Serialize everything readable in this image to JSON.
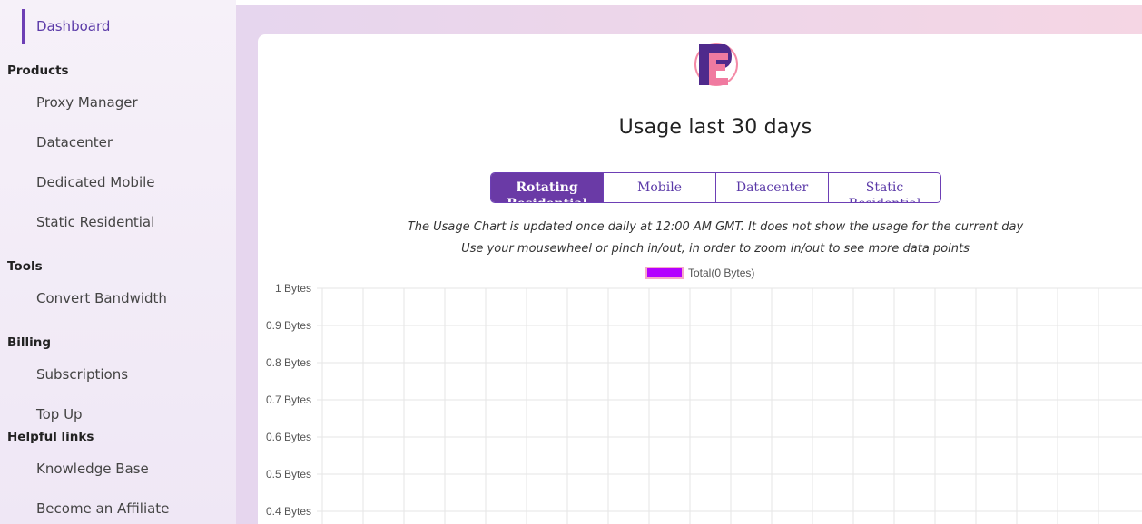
{
  "sidebar": {
    "active_item": "Dashboard",
    "sections": {
      "products": "Products",
      "tools": "Tools",
      "billing": "Billing",
      "helpful": "Helpful links"
    },
    "items": {
      "proxy_manager": "Proxy Manager",
      "datacenter": "Datacenter",
      "dedicated_mobile": "Dedicated Mobile",
      "static_residential": "Static Residential",
      "convert_bandwidth": "Convert Bandwidth",
      "subscriptions": "Subscriptions",
      "top_up": "Top Up",
      "knowledge_base": "Knowledge Base",
      "affiliate": "Become an Affiliate"
    }
  },
  "main": {
    "title": "Usage last 30 days",
    "tabs": {
      "rotating": "Rotating Residential",
      "mobile": "Mobile",
      "datacenter": "Datacenter",
      "static": "Static Residential"
    },
    "note1": "The Usage Chart is updated once daily at 12:00 AM GMT. It does not show the usage for the current day",
    "note2": "Use your mousewheel or pinch in/out, in order to zoom in/out to see more data points"
  },
  "colors": {
    "accent": "#6a3aa6",
    "series": "#b400ff",
    "series_border": "#f6a9c8"
  },
  "chart_data": {
    "type": "line",
    "legend": [
      "Total(0 Bytes)"
    ],
    "legend_position": "top-center",
    "y_tick_labels": [
      "1 Bytes",
      "0.9 Bytes",
      "0.8 Bytes",
      "0.7 Bytes",
      "0.6 Bytes",
      "0.5 Bytes",
      "0.4 Bytes"
    ],
    "ylim": [
      0,
      1
    ],
    "grid": true,
    "series": [
      {
        "name": "Total(0 Bytes)",
        "values": []
      }
    ]
  }
}
